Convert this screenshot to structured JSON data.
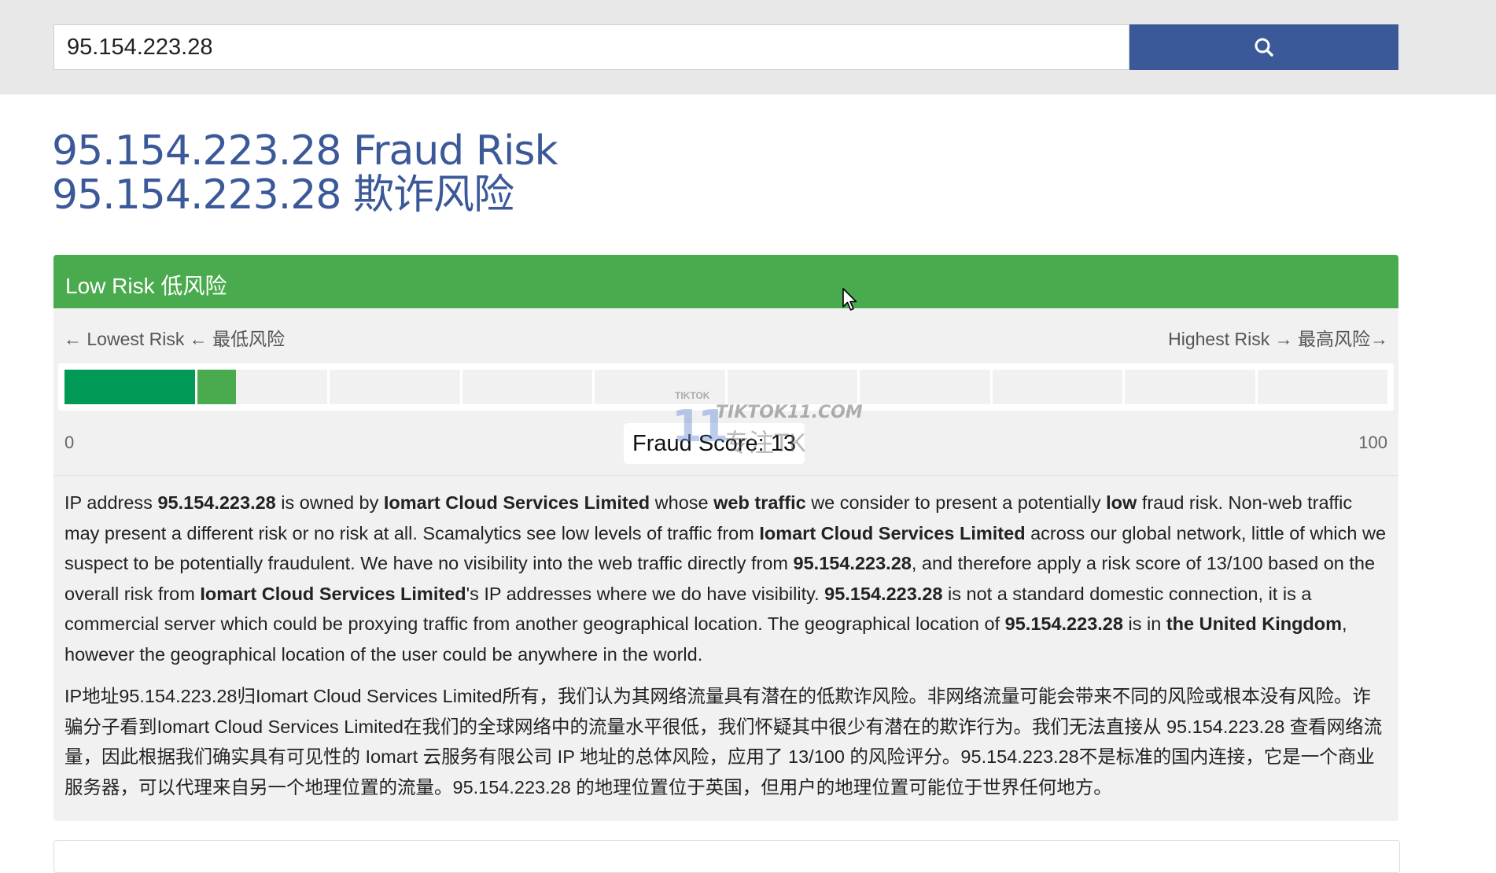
{
  "search": {
    "value": "95.154.223.28"
  },
  "icons": {
    "search": "search-icon",
    "cursor": "mouse-pointer-icon"
  },
  "title": {
    "line1": "95.154.223.28 Fraud Risk",
    "line2": "95.154.223.28 欺诈风险"
  },
  "risk": {
    "header": "Low Risk 低风险",
    "lowest_label": "← Lowest Risk ← 最低风险",
    "highest_label": "Highest Risk → 最高风险→",
    "min_label": "0",
    "max_label": "100",
    "score_label": "Fraud Score: 13",
    "score_value": 13,
    "score_max": 100,
    "segments": 10
  },
  "watermark": {
    "top": "TIKTOK",
    "number": "11",
    "site": "TIKTOK11.COM",
    "slogan": "专注TK"
  },
  "description_en": {
    "s1": "IP address ",
    "ip1": "95.154.223.28",
    "s2": " is owned by ",
    "org1": "Iomart Cloud Services Limited",
    "s3": " whose ",
    "web": "web traffic",
    "s4": " we consider to present a potentially ",
    "low": "low",
    "s5": " fraud risk. Non-web traffic may present a different risk or no risk at all. Scamalytics see low levels of traffic from ",
    "org2": "Iomart Cloud Services Limited",
    "s6": " across our global network, little of which we suspect to be potentially fraudulent. We have no visibility into the web traffic directly from ",
    "ip2": "95.154.223.28",
    "s7": ", and therefore apply a risk score of 13/100 based on the overall risk from ",
    "org3": "Iomart Cloud Services Limited",
    "s8": "'s IP addresses where we do have visibility. ",
    "ip3": "95.154.223.28",
    "s9": " is not a standard domestic connection, it is a commercial server which could be proxying traffic from another geographical location. The geographical location of ",
    "ip4": "95.154.223.28",
    "s10": " is in ",
    "country": "the United Kingdom",
    "s11": ", however the geographical location of the user could be anywhere in the world."
  },
  "description_zh": "IP地址95.154.223.28归Iomart Cloud Services Limited所有，我们认为其网络流量具有潜在的低欺诈风险。非网络流量可能会带来不同的风险或根本没有风险。诈骗分子看到Iomart Cloud Services Limited在我们的全球网络中的流量水平很低，我们怀疑其中很少有潜在的欺诈行为。我们无法直接从 95.154.223.28 查看网络流量，因此根据我们确实具有可见性的 Iomart 云服务有限公司 IP 地址的总体风险，应用了 13/100 的风险评分。95.154.223.28不是标准的国内连接，它是一个商业服务器，可以代理来自另一个地理位置的流量。95.154.223.28 的地理位置位于英国，但用户的地理位置可能位于世界任何地方。"
}
